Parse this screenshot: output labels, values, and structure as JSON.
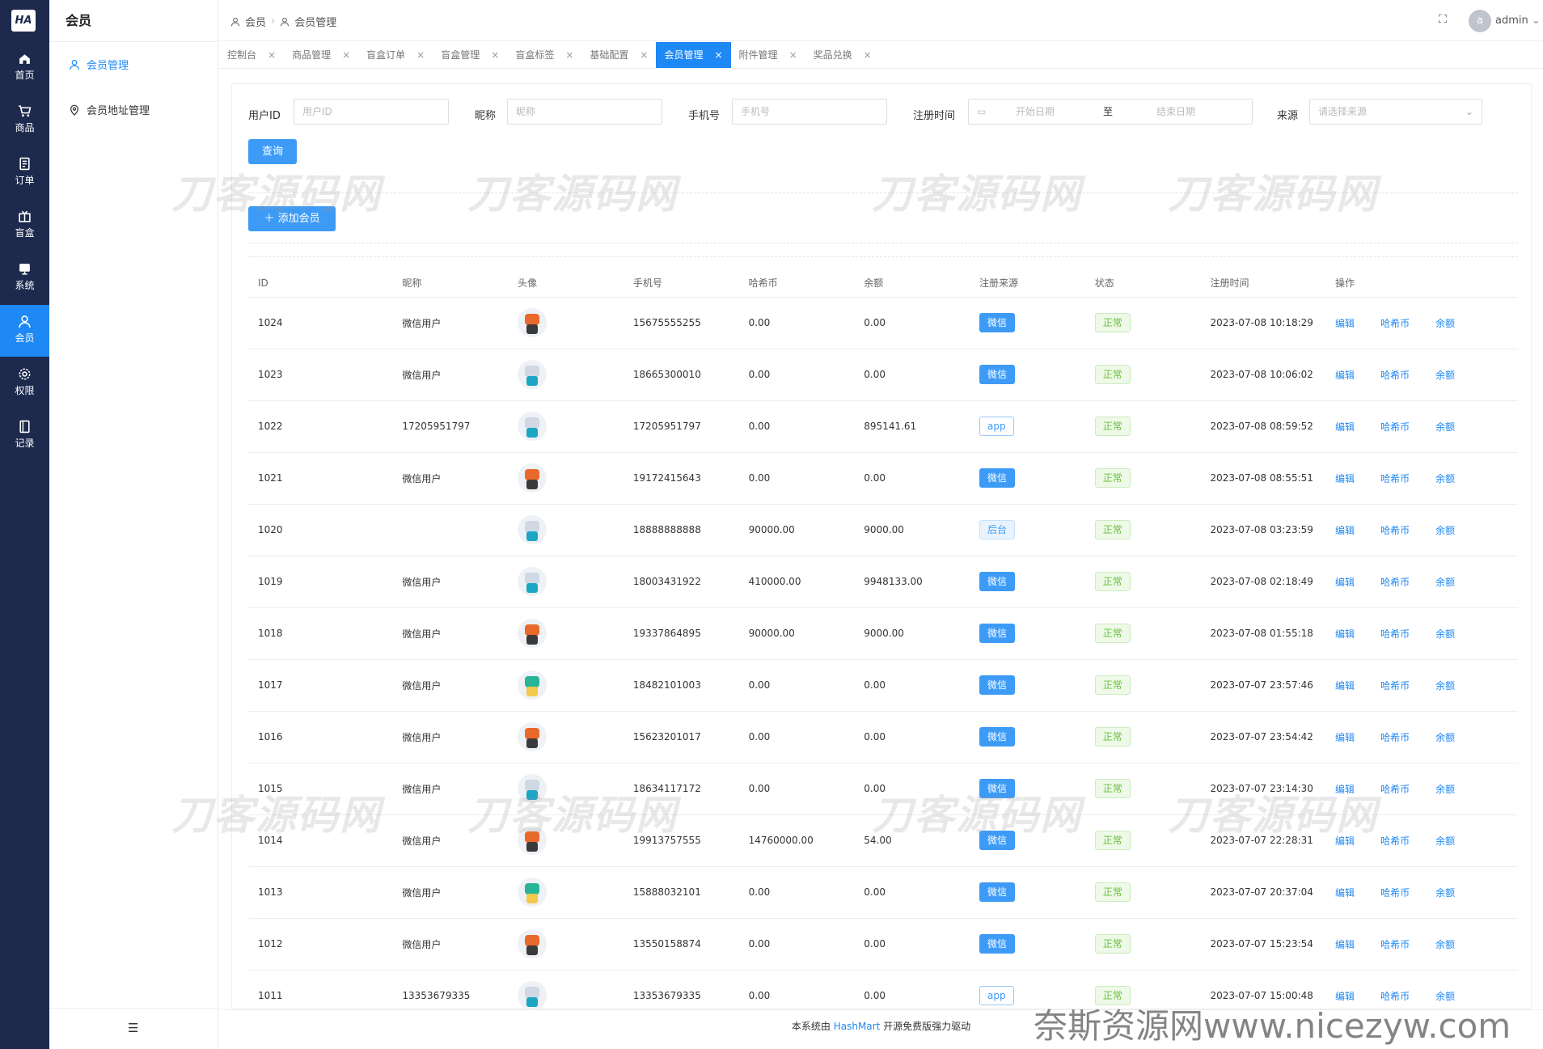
{
  "app": {
    "logo": "HA",
    "title": "会员"
  },
  "nav": [
    {
      "label": "首页",
      "icon": "home-icon"
    },
    {
      "label": "商品",
      "icon": "cart-icon"
    },
    {
      "label": "订单",
      "icon": "order-icon"
    },
    {
      "label": "盲盒",
      "icon": "box-icon"
    },
    {
      "label": "系统",
      "icon": "monitor-icon"
    },
    {
      "label": "会员",
      "icon": "user-icon",
      "active": true
    },
    {
      "label": "权限",
      "icon": "gear-icon"
    },
    {
      "label": "记录",
      "icon": "book-icon"
    }
  ],
  "sidebar": {
    "items": [
      {
        "label": "会员管理",
        "active": true
      },
      {
        "label": "会员地址管理"
      }
    ]
  },
  "breadcrumb": [
    "会员",
    "会员管理"
  ],
  "user": {
    "avatar": "a",
    "name": "admin"
  },
  "tabs": [
    {
      "label": "控制台"
    },
    {
      "label": "商品管理"
    },
    {
      "label": "盲盒订单"
    },
    {
      "label": "盲盒管理"
    },
    {
      "label": "盲盒标签"
    },
    {
      "label": "基础配置"
    },
    {
      "label": "会员管理",
      "active": true
    },
    {
      "label": "附件管理"
    },
    {
      "label": "奖品兑换"
    }
  ],
  "filters": {
    "user_id_label": "用户ID",
    "user_id_placeholder": "用户ID",
    "nickname_label": "昵称",
    "nickname_placeholder": "昵称",
    "phone_label": "手机号",
    "phone_placeholder": "手机号",
    "regtime_label": "注册时间",
    "start_placeholder": "开始日期",
    "range_sep": "至",
    "end_placeholder": "结束日期",
    "source_label": "来源",
    "source_placeholder": "请选择来源",
    "query_button": "查询"
  },
  "add_button": "添加会员",
  "table": {
    "columns": [
      "ID",
      "昵称",
      "头像",
      "手机号",
      "哈希币",
      "余额",
      "注册来源",
      "状态",
      "注册时间",
      "操作"
    ],
    "actions": [
      "编辑",
      "哈希币",
      "余额"
    ],
    "rows": [
      {
        "id": "1024",
        "nick": "微信用户",
        "avatar": "orange",
        "phone": "15675555255",
        "coin": "0.00",
        "balance": "0.00",
        "source": "微信",
        "src_style": "solid",
        "status": "正常",
        "time": "2023-07-08 10:18:29"
      },
      {
        "id": "1023",
        "nick": "微信用户",
        "avatar": "cyan",
        "phone": "18665300010",
        "coin": "0.00",
        "balance": "0.00",
        "source": "微信",
        "src_style": "solid",
        "status": "正常",
        "time": "2023-07-08 10:06:02"
      },
      {
        "id": "1022",
        "nick": "17205951797",
        "avatar": "cyan",
        "phone": "17205951797",
        "coin": "0.00",
        "balance": "895141.61",
        "source": "app",
        "src_style": "plain",
        "status": "正常",
        "time": "2023-07-08 08:59:52"
      },
      {
        "id": "1021",
        "nick": "微信用户",
        "avatar": "orange",
        "phone": "19172415643",
        "coin": "0.00",
        "balance": "0.00",
        "source": "微信",
        "src_style": "solid",
        "status": "正常",
        "time": "2023-07-08 08:55:51"
      },
      {
        "id": "1020",
        "nick": "",
        "avatar": "cyan",
        "phone": "18888888888",
        "coin": "90000.00",
        "balance": "9000.00",
        "source": "后台",
        "src_style": "light",
        "status": "正常",
        "time": "2023-07-08 03:23:59"
      },
      {
        "id": "1019",
        "nick": "微信用户",
        "avatar": "cyan",
        "phone": "18003431922",
        "coin": "410000.00",
        "balance": "9948133.00",
        "source": "微信",
        "src_style": "solid",
        "status": "正常",
        "time": "2023-07-08 02:18:49"
      },
      {
        "id": "1018",
        "nick": "微信用户",
        "avatar": "orange",
        "phone": "19337864895",
        "coin": "90000.00",
        "balance": "9000.00",
        "source": "微信",
        "src_style": "solid",
        "status": "正常",
        "time": "2023-07-08 01:55:18"
      },
      {
        "id": "1017",
        "nick": "微信用户",
        "avatar": "teal",
        "phone": "18482101003",
        "coin": "0.00",
        "balance": "0.00",
        "source": "微信",
        "src_style": "solid",
        "status": "正常",
        "time": "2023-07-07 23:57:46"
      },
      {
        "id": "1016",
        "nick": "微信用户",
        "avatar": "orange",
        "phone": "15623201017",
        "coin": "0.00",
        "balance": "0.00",
        "source": "微信",
        "src_style": "solid",
        "status": "正常",
        "time": "2023-07-07 23:54:42"
      },
      {
        "id": "1015",
        "nick": "微信用户",
        "avatar": "cyan",
        "phone": "18634117172",
        "coin": "0.00",
        "balance": "0.00",
        "source": "微信",
        "src_style": "solid",
        "status": "正常",
        "time": "2023-07-07 23:14:30"
      },
      {
        "id": "1014",
        "nick": "微信用户",
        "avatar": "orange",
        "phone": "19913757555",
        "coin": "14760000.00",
        "balance": "54.00",
        "source": "微信",
        "src_style": "solid",
        "status": "正常",
        "time": "2023-07-07 22:28:31"
      },
      {
        "id": "1013",
        "nick": "微信用户",
        "avatar": "teal",
        "phone": "15888032101",
        "coin": "0.00",
        "balance": "0.00",
        "source": "微信",
        "src_style": "solid",
        "status": "正常",
        "time": "2023-07-07 20:37:04"
      },
      {
        "id": "1012",
        "nick": "微信用户",
        "avatar": "orange",
        "phone": "13550158874",
        "coin": "0.00",
        "balance": "0.00",
        "source": "微信",
        "src_style": "solid",
        "status": "正常",
        "time": "2023-07-07 15:23:54"
      },
      {
        "id": "1011",
        "nick": "13353679335",
        "avatar": "cyan",
        "phone": "13353679335",
        "coin": "0.00",
        "balance": "0.00",
        "source": "app",
        "src_style": "plain",
        "status": "正常",
        "time": "2023-07-07 15:00:48"
      }
    ]
  },
  "footer": {
    "prefix": "本系统由",
    "link": "HashMart",
    "suffix": "开源免费版强力驱动"
  },
  "watermarks": {
    "mark": "刀客源码网",
    "corner": "奈斯资源网www.nicezyw.com"
  },
  "colors": {
    "nav_bg": "#1d2a4d",
    "accent": "#1e88f4",
    "success": "#67c23a"
  }
}
